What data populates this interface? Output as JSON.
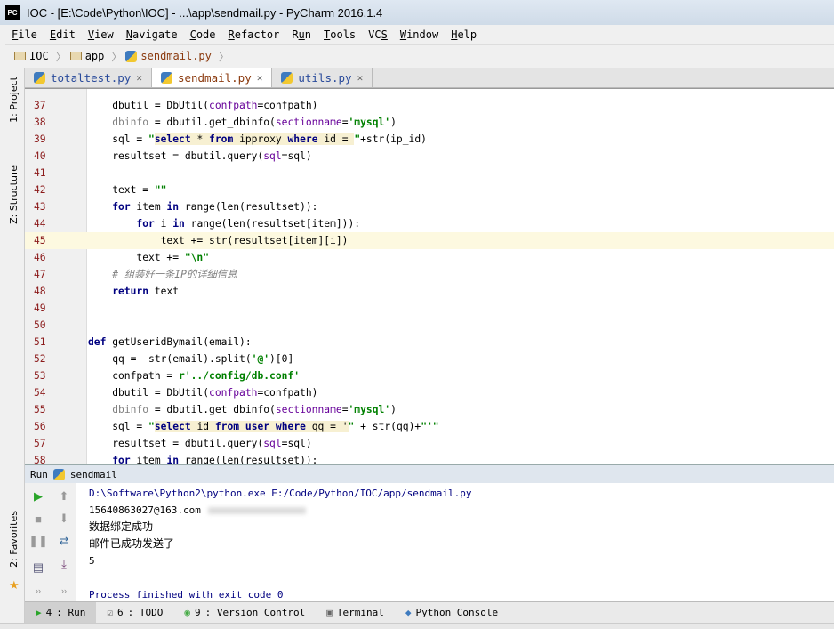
{
  "window": {
    "title": "IOC - [E:\\Code\\Python\\IOC] - ...\\app\\sendmail.py - PyCharm 2016.1.4",
    "logo": "PC"
  },
  "menu": [
    {
      "u": "F",
      "rest": "ile"
    },
    {
      "u": "E",
      "rest": "dit"
    },
    {
      "u": "V",
      "rest": "iew"
    },
    {
      "u": "N",
      "rest": "avigate"
    },
    {
      "u": "C",
      "rest": "ode"
    },
    {
      "u": "R",
      "rest": "efactor"
    },
    {
      "pre": "R",
      "u": "u",
      "rest": "n"
    },
    {
      "u": "T",
      "rest": "ools"
    },
    {
      "pre": "VC",
      "u": "S",
      "rest": ""
    },
    {
      "u": "W",
      "rest": "indow"
    },
    {
      "u": "H",
      "rest": "elp"
    }
  ],
  "breadcrumb": [
    "IOC",
    "app",
    "sendmail.py"
  ],
  "tabs": [
    {
      "label": "totaltest.py",
      "active": false
    },
    {
      "label": "sendmail.py",
      "active": true
    },
    {
      "label": "utils.py",
      "active": false
    }
  ],
  "left_strip": {
    "project": "1: Project",
    "structure": "Z: Structure",
    "favorites": "2: Favorites"
  },
  "code_lines": [
    {
      "n": "37",
      "t": [
        [
          "    dbutil = DbUtil(",
          ""
        ],
        [
          "confpath",
          "par"
        ],
        [
          "=confpath)",
          ""
        ]
      ]
    },
    {
      "n": "38",
      "t": [
        [
          "    ",
          ""
        ],
        [
          "dbinfo",
          "dim"
        ],
        [
          " = dbutil.get_dbinfo(",
          ""
        ],
        [
          "sectionname",
          "par"
        ],
        [
          "=",
          ""
        ],
        [
          "'mysql'",
          "str"
        ],
        [
          ")",
          ""
        ]
      ]
    },
    {
      "n": "39",
      "t": [
        [
          "    sql = ",
          ""
        ],
        [
          "\"",
          "str"
        ],
        [
          "select",
          "hlkw"
        ],
        [
          " * ",
          "hl"
        ],
        [
          "from",
          "hlkw"
        ],
        [
          " ipproxy ",
          "hl"
        ],
        [
          "where",
          "hlkw"
        ],
        [
          " id = ",
          "hl"
        ],
        [
          "\"",
          "str"
        ],
        [
          "+str(ip_id)",
          ""
        ]
      ]
    },
    {
      "n": "40",
      "t": [
        [
          "    resultset = dbutil.query(",
          ""
        ],
        [
          "sql",
          "par"
        ],
        [
          "=sql)",
          ""
        ]
      ]
    },
    {
      "n": "41",
      "t": []
    },
    {
      "n": "42",
      "t": [
        [
          "    text = ",
          ""
        ],
        [
          "\"\"",
          "str"
        ]
      ]
    },
    {
      "n": "43",
      "t": [
        [
          "    ",
          ""
        ],
        [
          "for",
          "kw"
        ],
        [
          " item ",
          ""
        ],
        [
          "in",
          "kw"
        ],
        [
          " range(len(resultset)):",
          ""
        ]
      ]
    },
    {
      "n": "44",
      "t": [
        [
          "        ",
          ""
        ],
        [
          "for",
          "kw"
        ],
        [
          " i ",
          ""
        ],
        [
          "in",
          "kw"
        ],
        [
          " range(len(resultset[item])):",
          ""
        ]
      ]
    },
    {
      "n": "45",
      "t": [
        [
          "            text += str(resultset[item][i])",
          ""
        ]
      ],
      "current": true
    },
    {
      "n": "46",
      "t": [
        [
          "        text += ",
          ""
        ],
        [
          "\"\\n\"",
          "str"
        ]
      ]
    },
    {
      "n": "47",
      "t": [
        [
          "    ",
          ""
        ],
        [
          "# 组装好一条IP的详细信息",
          "cm"
        ]
      ]
    },
    {
      "n": "48",
      "t": [
        [
          "    ",
          ""
        ],
        [
          "return",
          "kw"
        ],
        [
          " text",
          ""
        ]
      ]
    },
    {
      "n": "49",
      "t": []
    },
    {
      "n": "50",
      "t": []
    },
    {
      "n": "51",
      "t": [
        [
          "def",
          "kw"
        ],
        [
          " getUseridBymail(email):",
          ""
        ]
      ]
    },
    {
      "n": "52",
      "t": [
        [
          "    qq =  str(email).split(",
          ""
        ],
        [
          "'@'",
          "str"
        ],
        [
          ")[0]",
          ""
        ]
      ]
    },
    {
      "n": "53",
      "t": [
        [
          "    confpath = ",
          ""
        ],
        [
          "r'../config/db.conf'",
          "str"
        ]
      ]
    },
    {
      "n": "54",
      "t": [
        [
          "    dbutil = DbUtil(",
          ""
        ],
        [
          "confpath",
          "par"
        ],
        [
          "=confpath)",
          ""
        ]
      ]
    },
    {
      "n": "55",
      "t": [
        [
          "    ",
          ""
        ],
        [
          "dbinfo",
          "dim"
        ],
        [
          " = dbutil.get_dbinfo(",
          ""
        ],
        [
          "sectionname",
          "par"
        ],
        [
          "=",
          ""
        ],
        [
          "'mysql'",
          "str"
        ],
        [
          ")",
          ""
        ]
      ]
    },
    {
      "n": "56",
      "t": [
        [
          "    sql = ",
          ""
        ],
        [
          "\"",
          "str"
        ],
        [
          "select",
          "hlkw"
        ],
        [
          " id ",
          "hl"
        ],
        [
          "from",
          "hlkw"
        ],
        [
          " ",
          "hl"
        ],
        [
          "user",
          "hlkw"
        ],
        [
          " ",
          "hl"
        ],
        [
          "where",
          "hlkw"
        ],
        [
          " qq = '",
          "hl"
        ],
        [
          "\"",
          "str"
        ],
        [
          " + str(qq)+",
          ""
        ],
        [
          "\"'\"",
          "str"
        ]
      ]
    },
    {
      "n": "57",
      "t": [
        [
          "    resultset = dbutil.query(",
          ""
        ],
        [
          "sql",
          "par"
        ],
        [
          "=sql)",
          ""
        ]
      ]
    },
    {
      "n": "58",
      "t": [
        [
          "    ",
          ""
        ],
        [
          "for",
          "kw"
        ],
        [
          " item ",
          ""
        ],
        [
          "in",
          "kw"
        ],
        [
          " range(len(resultset)):",
          ""
        ]
      ]
    }
  ],
  "run_panel": {
    "label": "Run",
    "config": "sendmail"
  },
  "console": {
    "command": "D:\\Software\\Python2\\python.exe E:/Code/Python/IOC/app/sendmail.py",
    "lines": [
      "15640863027@163.com",
      "数据绑定成功",
      "邮件已成功发送了",
      "5"
    ],
    "exit": "Process finished with exit code 0"
  },
  "bottom_tools": [
    {
      "u": "4",
      "rest": ": Run",
      "active": true
    },
    {
      "u": "6",
      "rest": ": TODO"
    },
    {
      "u": "9",
      "rest": ": Version Control"
    },
    {
      "u": "",
      "rest": "Terminal"
    },
    {
      "u": "",
      "rest": "Python Console"
    }
  ]
}
